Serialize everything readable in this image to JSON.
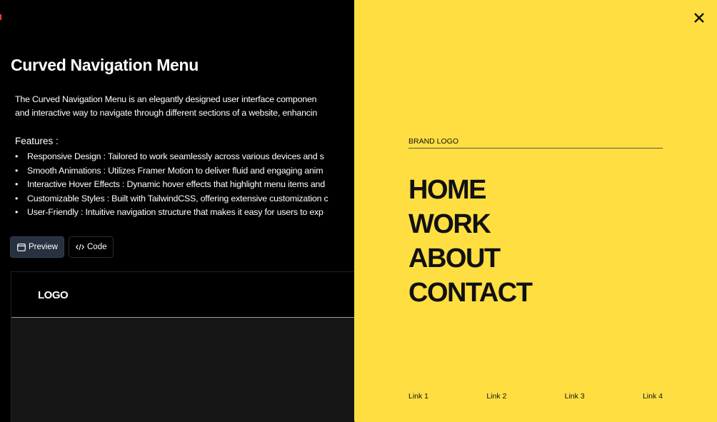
{
  "page": {
    "title": "Curved Navigation Menu",
    "description": [
      "The Curved Navigation Menu is an elegantly designed user interface componen",
      "and interactive way to navigate through different sections of a website, enhancin"
    ],
    "features_title": "Features :",
    "features": [
      "Responsive Design : Tailored to work seamlessly across various devices and s",
      "Smooth Animations : Utilizes Framer Motion to deliver fluid and engaging anim",
      "Interactive Hover Effects : Dynamic hover effects that highlight menu items and",
      "Customizable Styles : Built with TailwindCSS, offering extensive customization c",
      "User-Friendly : Intuitive navigation structure that makes it easy for users to exp"
    ]
  },
  "tabs": {
    "preview_label": "Preview",
    "code_label": "Code",
    "active": "Preview"
  },
  "demo": {
    "logo": "LOGO"
  },
  "menu_panel": {
    "brand": "BRAND LOGO",
    "items": [
      "HOME",
      "WORK",
      "ABOUT",
      "CONTACT"
    ],
    "footer_links": [
      "Link 1",
      "Link 2",
      "Link 3",
      "Link 4"
    ],
    "background_color": "#ffde42"
  },
  "icons": {
    "close": "close-icon",
    "preview": "window-icon",
    "code": "code-icon"
  }
}
